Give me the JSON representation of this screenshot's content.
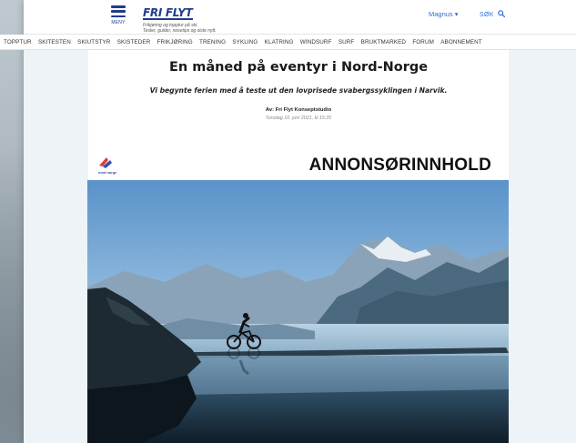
{
  "header": {
    "menu_label": "MENY",
    "logo_text": "FRI FLYT",
    "tagline_line1": "Frikjøring og topptur på ski.",
    "tagline_line2": "Tester, guider, reisetips og siste nytt.",
    "user_label": "Magnus ▾",
    "search_label": "SØK"
  },
  "nav": {
    "items": [
      "TOPPTUR",
      "SKITESTEN",
      "SKIUTSTYR",
      "SKISTEDER",
      "FRIKJØRING",
      "TRENING",
      "SYKLING",
      "KLATRING",
      "WINDSURF",
      "SURF",
      "BRUKTMARKED",
      "FORUM",
      "ABONNEMENT"
    ]
  },
  "article": {
    "title": "En måned på eventyr i Nord-Norge",
    "subtitle": "Vi begynte ferien med å teste ut den lovprisede svabergssyklingen i Narvik.",
    "byline": "Av: Fri Flyt Konseptstudio",
    "date": "Torsdag 10. juni 2021, kl 15:25",
    "sponsor_logo_text": "nord norge",
    "ad_label": "ANNONSØRINNHOLD"
  },
  "colors": {
    "brand": "#1f3c8c",
    "link": "#2f6fd0",
    "page_bg": "#eef3f7"
  },
  "icons": {
    "menu": "hamburger-icon",
    "search": "search-icon",
    "sponsor": "nord-norge-logo"
  }
}
